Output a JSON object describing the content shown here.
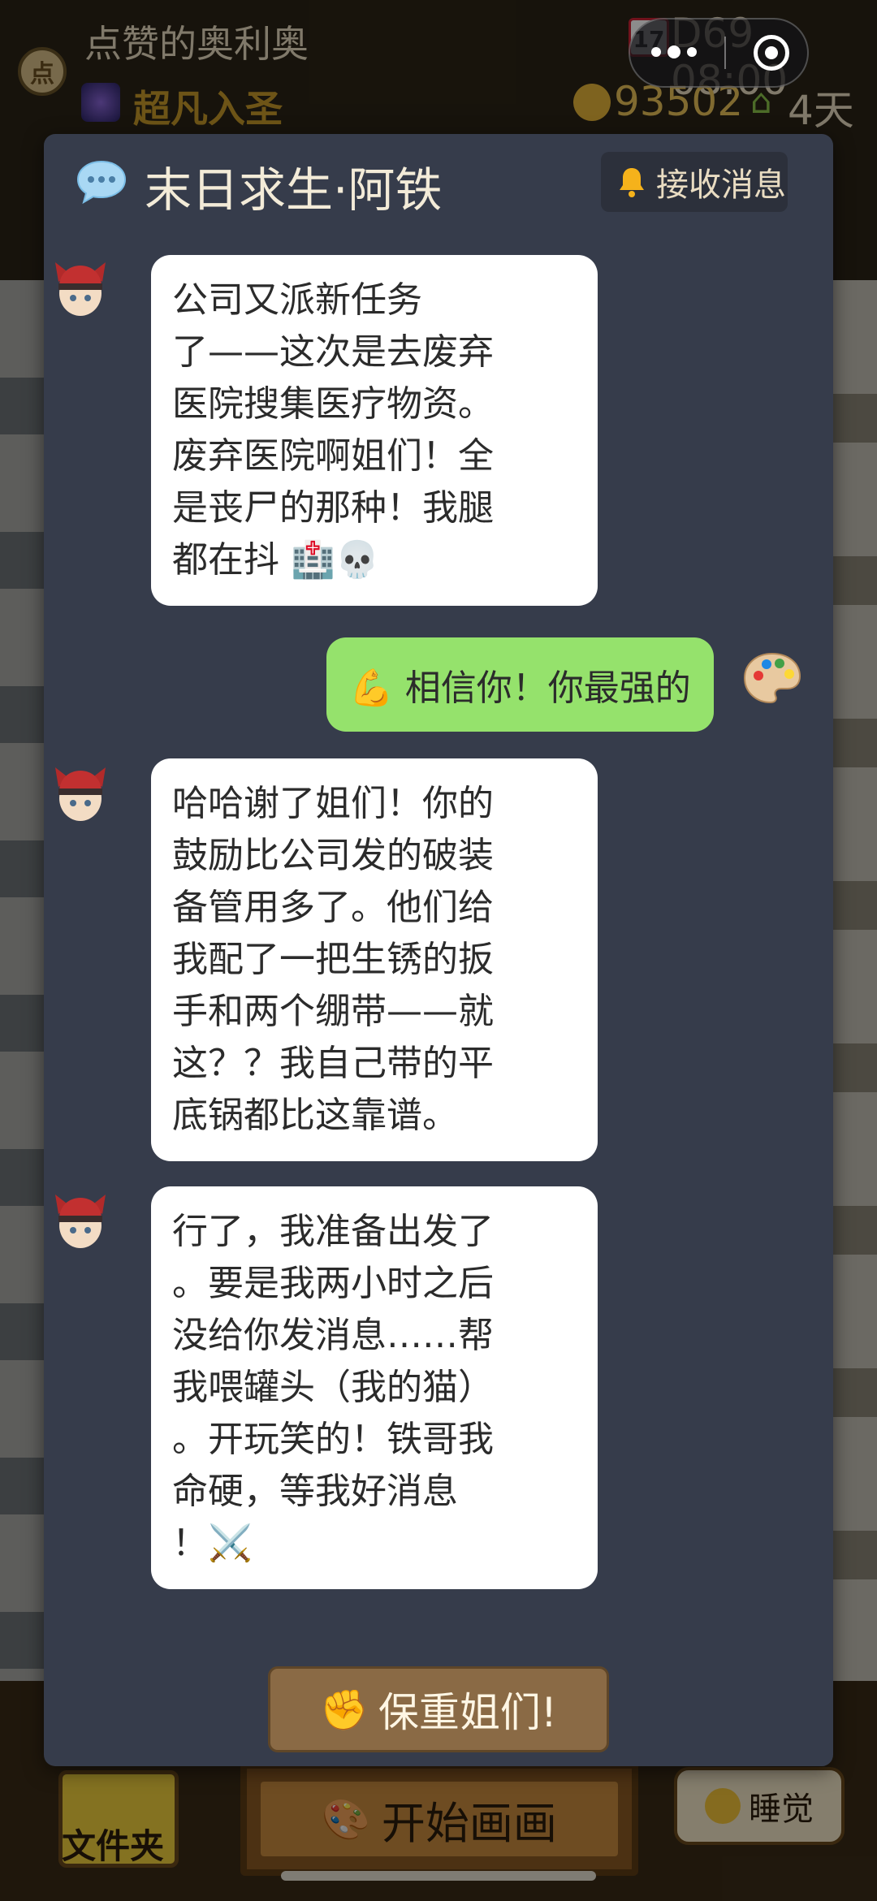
{
  "hud": {
    "avatar_char": "点",
    "player_name": "点赞的奥利奥",
    "rank": "超凡入圣",
    "calendar_date": "17",
    "day_time": "D69 08:00",
    "coins": "93502",
    "days": "4天"
  },
  "dialog": {
    "title": "末日求生·阿铁",
    "subscribe_label": "接收消息",
    "messages": [
      {
        "sender": "npc",
        "text": "公司又派新任务\n了——这次是去废弃\n医院搜集医疗物资。\n废弃医院啊姐们！全\n是丧尸的那种！我腿\n都在抖 🏥💀"
      },
      {
        "sender": "me",
        "text": "💪 相信你！你最强的"
      },
      {
        "sender": "npc",
        "text": "哈哈谢了姐们！你的\n鼓励比公司发的破装\n备管用多了。他们给\n我配了一把生锈的扳\n手和两个绷带——就\n这？？我自己带的平\n底锅都比这靠谱。"
      },
      {
        "sender": "npc",
        "text": "行了，我准备出发了\n。要是我两小时之后\n没给你发消息……帮\n我喂罐头（我的猫）\n。开玩笑的！铁哥我\n命硬，等我好消息\n！⚔️"
      }
    ],
    "action_icon": "✊",
    "action_label": "保重姐们!"
  },
  "bottom_bar": {
    "folder_label": "文件夹",
    "draw_icon": "🎨",
    "draw_label": "开始画画",
    "sleep_label": "睡觉"
  },
  "colors": {
    "modal_bg": "#363c4b",
    "npc_bubble": "#ffffff",
    "my_bubble": "#95e26c",
    "action_btn": "#8a6a45"
  }
}
